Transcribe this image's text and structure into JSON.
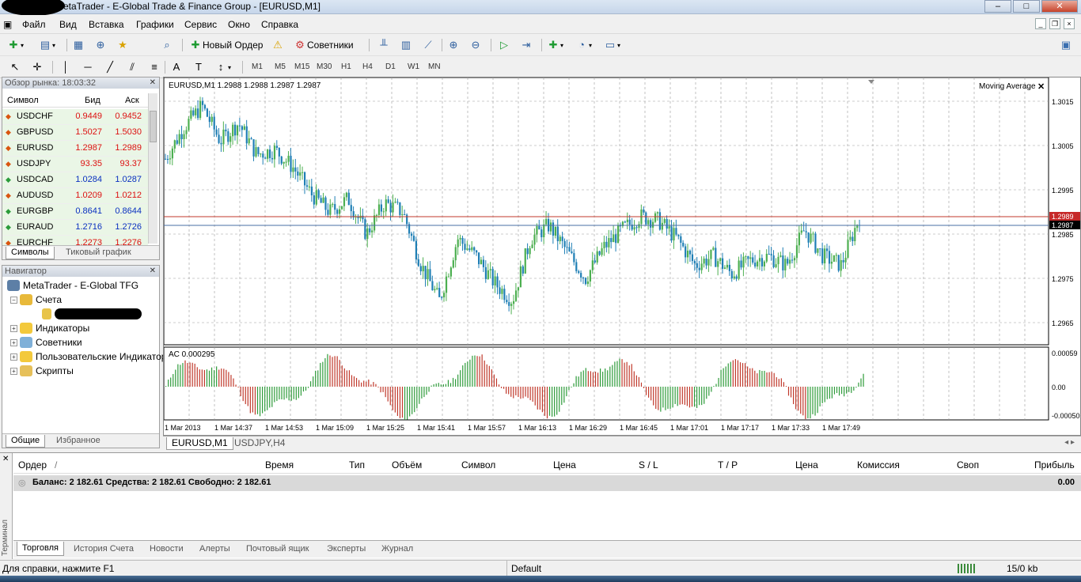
{
  "window": {
    "title": "MetaTrader - E-Global Trade & Finance Group - [EURUSD,M1]",
    "min": "‒",
    "max": "□",
    "close": "✕"
  },
  "menu": [
    "Файл",
    "Вид",
    "Вставка",
    "Графики",
    "Сервис",
    "Окно",
    "Справка"
  ],
  "toolbar": {
    "new_order": "Новый Ордер",
    "experts": "Советники",
    "timeframes": [
      "M1",
      "M5",
      "M15",
      "M30",
      "H1",
      "H4",
      "D1",
      "W1",
      "MN"
    ]
  },
  "market_watch": {
    "title": "Обзор рынка: 18:03:32",
    "col_symbol": "Символ",
    "col_bid": "Бид",
    "col_ask": "Аск",
    "rows": [
      {
        "symbol": "USDCHF",
        "bid": "0.9449",
        "ask": "0.9452",
        "dir": "down"
      },
      {
        "symbol": "GBPUSD",
        "bid": "1.5027",
        "ask": "1.5030",
        "dir": "down"
      },
      {
        "symbol": "EURUSD",
        "bid": "1.2987",
        "ask": "1.2989",
        "dir": "down"
      },
      {
        "symbol": "USDJPY",
        "bid": "93.35",
        "ask": "93.37",
        "dir": "down"
      },
      {
        "symbol": "USDCAD",
        "bid": "1.0284",
        "ask": "1.0287",
        "dir": "up"
      },
      {
        "symbol": "AUDUSD",
        "bid": "1.0209",
        "ask": "1.0212",
        "dir": "down"
      },
      {
        "symbol": "EURGBP",
        "bid": "0.8641",
        "ask": "0.8644",
        "dir": "up"
      },
      {
        "symbol": "EURAUD",
        "bid": "1.2716",
        "ask": "1.2726",
        "dir": "up"
      },
      {
        "symbol": "EURCHF",
        "bid": "1.2273",
        "ask": "1.2276",
        "dir": "down"
      }
    ],
    "tab_symbols": "Символы",
    "tab_tick": "Тиковый график"
  },
  "navigator": {
    "title": "Навигатор",
    "root": "MetaTrader - E-Global TFG",
    "accounts": "Счета",
    "indicators": "Индикаторы",
    "experts": "Советники",
    "custom": "Пользовательские Индикаторы",
    "scripts": "Скрипты",
    "tab_common": "Общие",
    "tab_favorites": "Избранное"
  },
  "chart": {
    "header": "EURUSD,M1  1.2988 1.2988 1.2987 1.2987",
    "indicator": "Moving Average",
    "ac_label": "AC 0.000295",
    "price_labels": [
      "1.3015",
      "1.3005",
      "1.2995",
      "1.2985",
      "1.2975",
      "1.2965"
    ],
    "ask_tag": "1.2989",
    "bid_tag": "1.2987",
    "ac_labels": [
      "0.00059",
      "0.00",
      "-0.00050"
    ],
    "time_labels": [
      "1 Mar 2013",
      "1 Mar 14:37",
      "1 Mar 14:53",
      "1 Mar 15:09",
      "1 Mar 15:25",
      "1 Mar 15:41",
      "1 Mar 15:57",
      "1 Mar 16:13",
      "1 Mar 16:29",
      "1 Mar 16:45",
      "1 Mar 17:01",
      "1 Mar 17:17",
      "1 Mar 17:33",
      "1 Mar 17:49"
    ],
    "tabs": [
      "EURUSD,M1",
      "USDJPY,H4"
    ],
    "colors": {
      "bull": "#4caf50",
      "bear": "#1f7fb5",
      "ask_line": "#c0392b",
      "bid_line": "#4a6fa5",
      "ac_up": "#2e9b3a",
      "ac_down": "#c0392b"
    }
  },
  "terminal": {
    "side_label": "Терминал",
    "columns": [
      "Ордер",
      "/",
      "Время",
      "Тип",
      "Объём",
      "Символ",
      "Цена",
      "S / L",
      "T / P",
      "Цена",
      "Комиссия",
      "Своп",
      "Прибыль"
    ],
    "balance": "Баланс: 2 182.61  Средства: 2 182.61  Свободно: 2 182.61",
    "profit": "0.00",
    "tabs": [
      "Торговля",
      "История Счета",
      "Новости",
      "Алерты",
      "Почтовый ящик",
      "Эксперты",
      "Журнал"
    ]
  },
  "status": {
    "help": "Для справки, нажмите F1",
    "profile": "Default",
    "traffic": "15/0 kb"
  }
}
